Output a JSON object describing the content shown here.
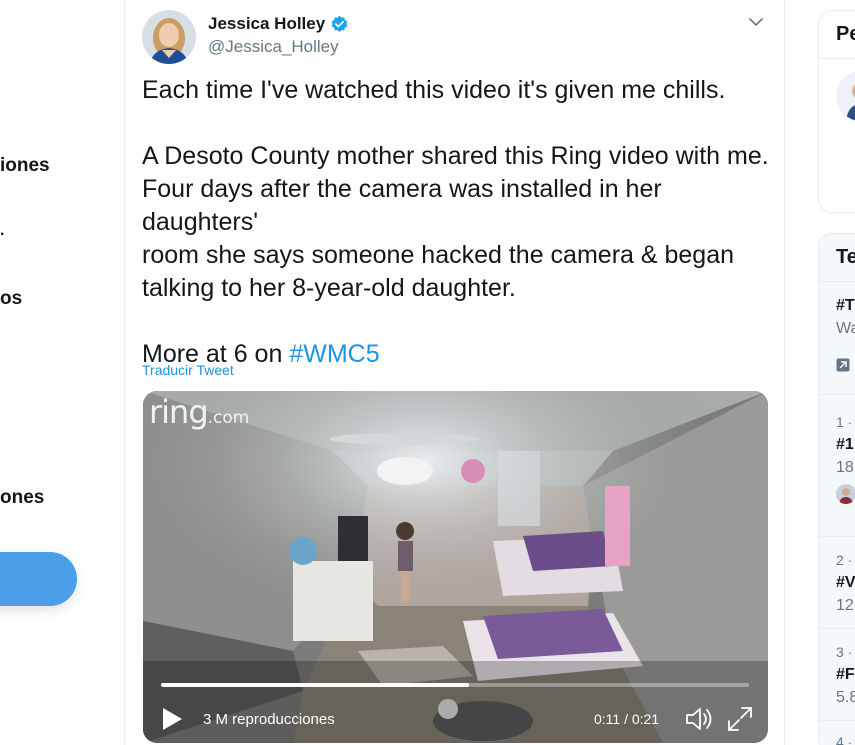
{
  "left_nav": {
    "items": [
      {
        "label": "iones"
      },
      {
        "label": "os"
      },
      {
        "label": "ones"
      }
    ],
    "fragment": "."
  },
  "tweet": {
    "author_name": "Jessica Holley",
    "author_handle": "@Jessica_Holley",
    "text_lines": [
      "Each time I've watched this video it's given me chills.",
      "",
      "A Desoto County mother shared this Ring video with me.",
      "Four days after the camera was installed in her daughters'",
      "room she says someone hacked the camera & began",
      "talking to her 8-year-old daughter.",
      "",
      "More at 6 on "
    ],
    "hashtag": "#WMC5",
    "translate_label": "Traducir Tweet"
  },
  "video": {
    "watermark": "ring",
    "watermark_suffix": ".com",
    "views_label": "3 M reproducciones",
    "time_label": "0:11 / 0:21",
    "progress_fraction": 0.524
  },
  "sidebar": {
    "panel1_title": "Pe",
    "panel2_title": "Te",
    "trends": [
      {
        "meta": "",
        "tag": "#T",
        "count": "Wa"
      },
      {
        "meta": "1 ·",
        "tag": "#1",
        "count": "18,"
      },
      {
        "meta": "2 ·",
        "tag": "#V",
        "count": "12,"
      },
      {
        "meta": "3 ·",
        "tag": "#F",
        "count": "5.8"
      },
      {
        "meta": "4 ·",
        "tag": "",
        "count": ""
      }
    ]
  },
  "colors": {
    "accent": "#1b95e0",
    "button": "#4a9fe8",
    "verified": "#1da1f2"
  }
}
